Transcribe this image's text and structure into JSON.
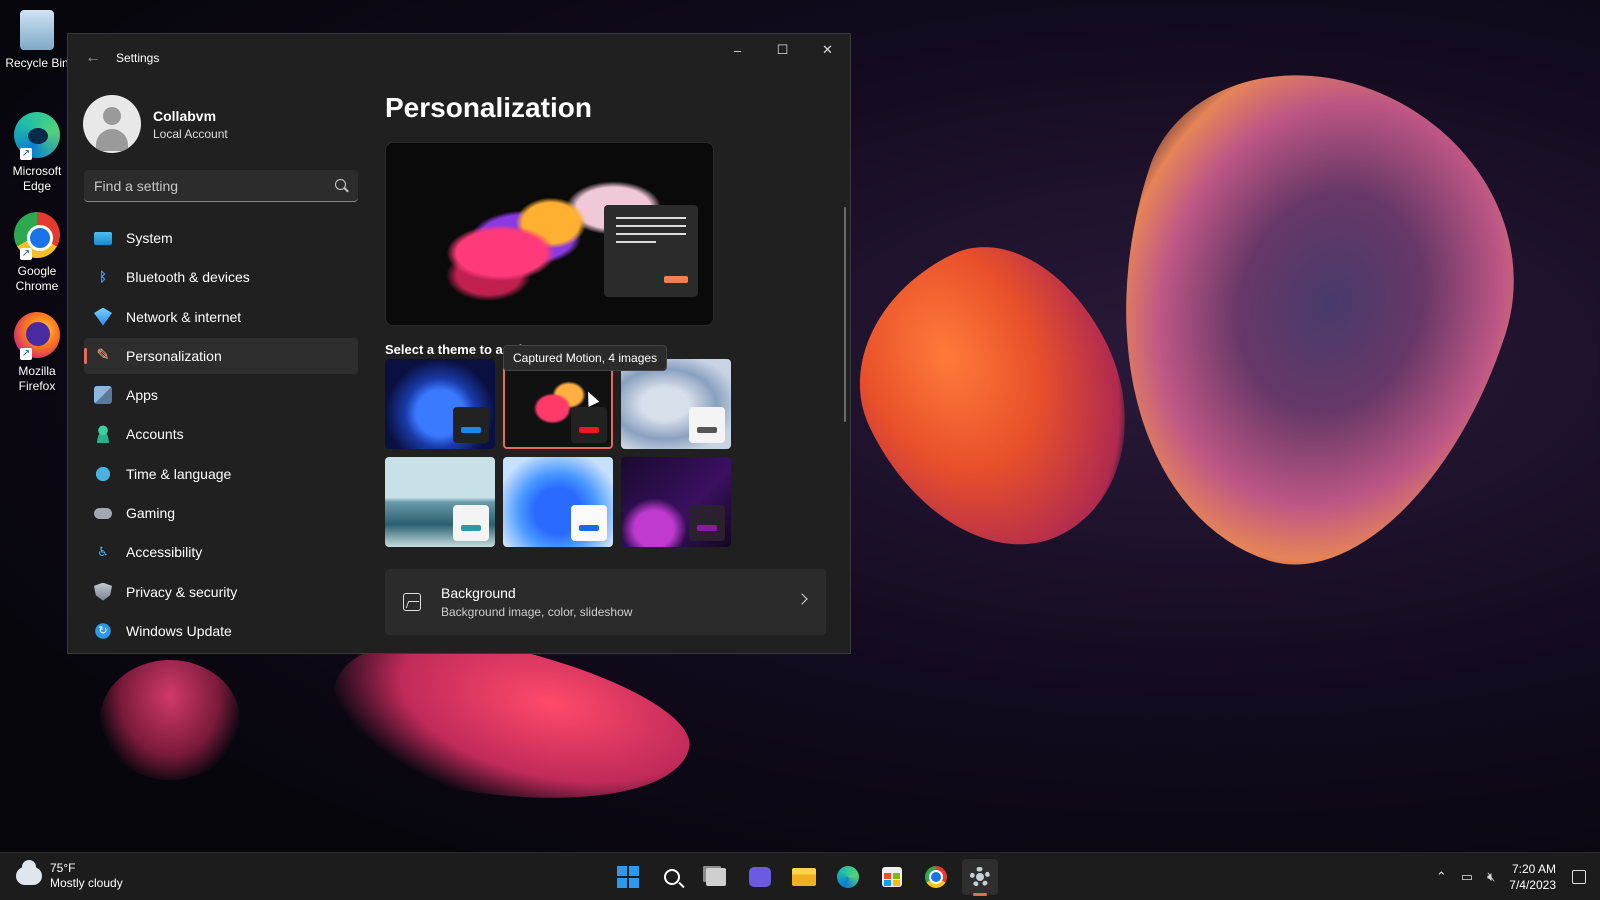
{
  "desktop": {
    "icons": [
      {
        "label": "Recycle Bin",
        "icon": "recycle-bin-icon"
      },
      {
        "label": "Microsoft Edge",
        "icon": "edge-icon"
      },
      {
        "label": "Google Chrome",
        "icon": "chrome-icon"
      },
      {
        "label": "Mozilla Firefox",
        "icon": "firefox-icon"
      }
    ]
  },
  "window": {
    "title": "Settings",
    "controls": {
      "minimize": "–",
      "maximize": "☐",
      "close": "✕"
    }
  },
  "profile": {
    "name": "Collabvm",
    "account_type": "Local Account"
  },
  "search": {
    "placeholder": "Find a setting",
    "value": ""
  },
  "sidebar": {
    "items": [
      {
        "label": "System",
        "icon": "system-icon"
      },
      {
        "label": "Bluetooth & devices",
        "icon": "bluetooth-icon"
      },
      {
        "label": "Network & internet",
        "icon": "network-icon"
      },
      {
        "label": "Personalization",
        "icon": "personalization-icon",
        "active": true
      },
      {
        "label": "Apps",
        "icon": "apps-icon"
      },
      {
        "label": "Accounts",
        "icon": "accounts-icon"
      },
      {
        "label": "Time & language",
        "icon": "time-language-icon"
      },
      {
        "label": "Gaming",
        "icon": "gaming-icon"
      },
      {
        "label": "Accessibility",
        "icon": "accessibility-icon"
      },
      {
        "label": "Privacy & security",
        "icon": "privacy-icon"
      },
      {
        "label": "Windows Update",
        "icon": "windows-update-icon"
      }
    ]
  },
  "main": {
    "title": "Personalization",
    "themes_label": "Select a theme to apply",
    "tooltip": "Captured Motion, 4 images",
    "themes": [
      {
        "id": "windows-dark-blue",
        "selected": false
      },
      {
        "id": "captured-motion",
        "selected": true
      },
      {
        "id": "windows-light-glow",
        "selected": false
      },
      {
        "id": "lake-light",
        "selected": false
      },
      {
        "id": "windows-light-blue",
        "selected": false
      },
      {
        "id": "purple-glow",
        "selected": false
      }
    ],
    "background_card": {
      "title": "Background",
      "subtitle": "Background image, color, slideshow"
    }
  },
  "taskbar": {
    "weather": {
      "temp": "75°F",
      "condition": "Mostly cloudy"
    },
    "apps": [
      "start-icon",
      "search-icon",
      "task-view-icon",
      "chat-icon",
      "file-explorer-icon",
      "edge-icon",
      "store-icon",
      "chrome-icon",
      "settings-icon"
    ],
    "active_app": "settings-icon",
    "clock": {
      "time": "7:20 AM",
      "date": "7/4/2023"
    }
  },
  "colors": {
    "accent": "#e86a5a",
    "window_bg": "#202020",
    "taskbar_bg": "#1c1c1c"
  }
}
